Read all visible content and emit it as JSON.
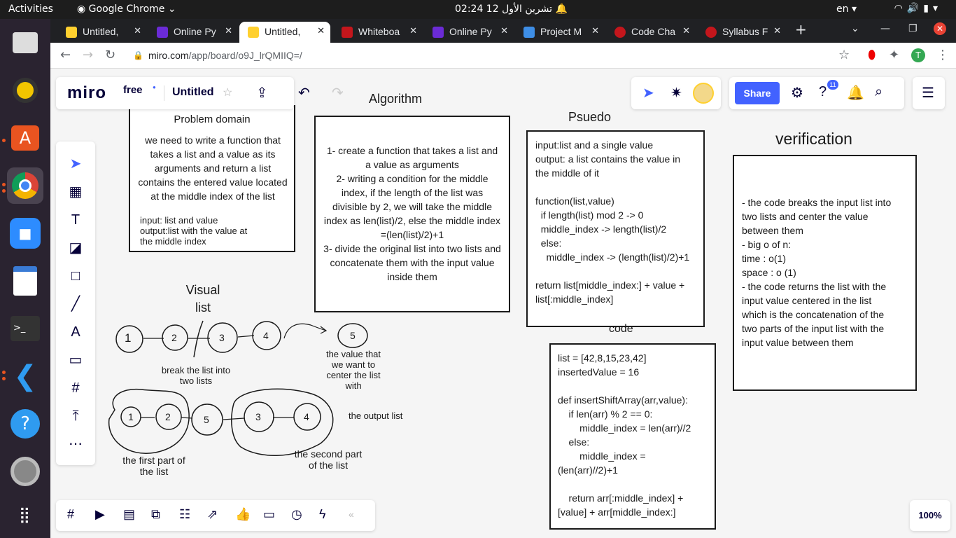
{
  "system": {
    "activities": "Activities",
    "app_name": "Google Chrome",
    "clock": "02:24  12 تشرين الأول",
    "language": "en"
  },
  "browser": {
    "tabs": [
      {
        "label": "Untitled,",
        "color": "#ffd02f"
      },
      {
        "label": "Online Py",
        "color": "#6b2bd6"
      },
      {
        "label": "Untitled,",
        "color": "#ffd02f"
      },
      {
        "label": "Whiteboa",
        "color": "#c4161c"
      },
      {
        "label": "Online Py",
        "color": "#6b2bd6"
      },
      {
        "label": "Project M",
        "color": "#3e8ee6"
      },
      {
        "label": "Code Cha",
        "color": "#c4161c"
      },
      {
        "label": "Syllabus F",
        "color": "#c4161c"
      }
    ],
    "url_host": "miro.com",
    "url_path": "/app/board/o9J_lrQMIIQ=/",
    "profile_initial": "T"
  },
  "miro": {
    "logo": "miro",
    "plan": "free",
    "board_title": "Untitled",
    "share_label": "Share",
    "notification_count": "11",
    "zoom": "100%"
  },
  "board": {
    "problem_domain": {
      "title": "Problem domain",
      "body": "we need to write a function that takes a list and a value as its arguments and return a list contains the entered value located at the middle index of the list",
      "io": "input: list and value\noutput:list with the value at\nthe middle index"
    },
    "algorithm": {
      "title": "Algorithm",
      "body": "1- create a function that takes a list and a value as arguments\n2- writing a condition for the middle index, if the length of the list was divisible by 2, we will take the middle index as len(list)/2, else the middle index =(len(list)/2)+1\n3- divide the original list into two lists and concatenate them with the input value inside them"
    },
    "pseudo": {
      "title": "Psuedo",
      "body": "input:list and a single value\noutput: a list contains the value in\nthe middle of it\n\nfunction(list,value)\n  if length(list) mod 2 -> 0\n  middle_index -> length(list)/2\n  else:\n    middle_index -> (length(list)/2)+1\n\nreturn list[middle_index:] + value +\nlist[:middle_index]"
    },
    "verification": {
      "title": "verification",
      "body": "- the code breaks the input list into\ntwo lists and center the value\nbetween them\n- big o of n:\ntime : o(1)\nspace : o (1)\n- the code returns the list with the\ninput value centered in the list\nwhich is the concatenation of the\ntwo parts of the input list with the\ninput value between them"
    },
    "code": {
      "title": "code",
      "body": "list = [42,8,15,23,42]\ninsertedValue = 16\n\ndef insertShiftArray(arr,value):\n    if len(arr) % 2 == 0:\n        middle_index = len(arr)//2\n    else:\n        middle_index =\n(len(arr)//2)+1\n\n    return arr[:middle_index] +\n[value] + arr[middle_index:]"
    },
    "visual": {
      "title": "Visual\nlist",
      "top_nodes": [
        "1",
        "2",
        "3",
        "4"
      ],
      "value_node": "5",
      "break_label": "break the list into\ntwo lists",
      "value_label": "the value that\nwe want to\ncenter the list\nwith",
      "bottom_nodes": [
        "1",
        "2",
        "5",
        "3",
        "4"
      ],
      "output_label": "the output list",
      "first_part_label": "the first part of\nthe list",
      "second_part_label": "the second part\nof the list"
    }
  }
}
